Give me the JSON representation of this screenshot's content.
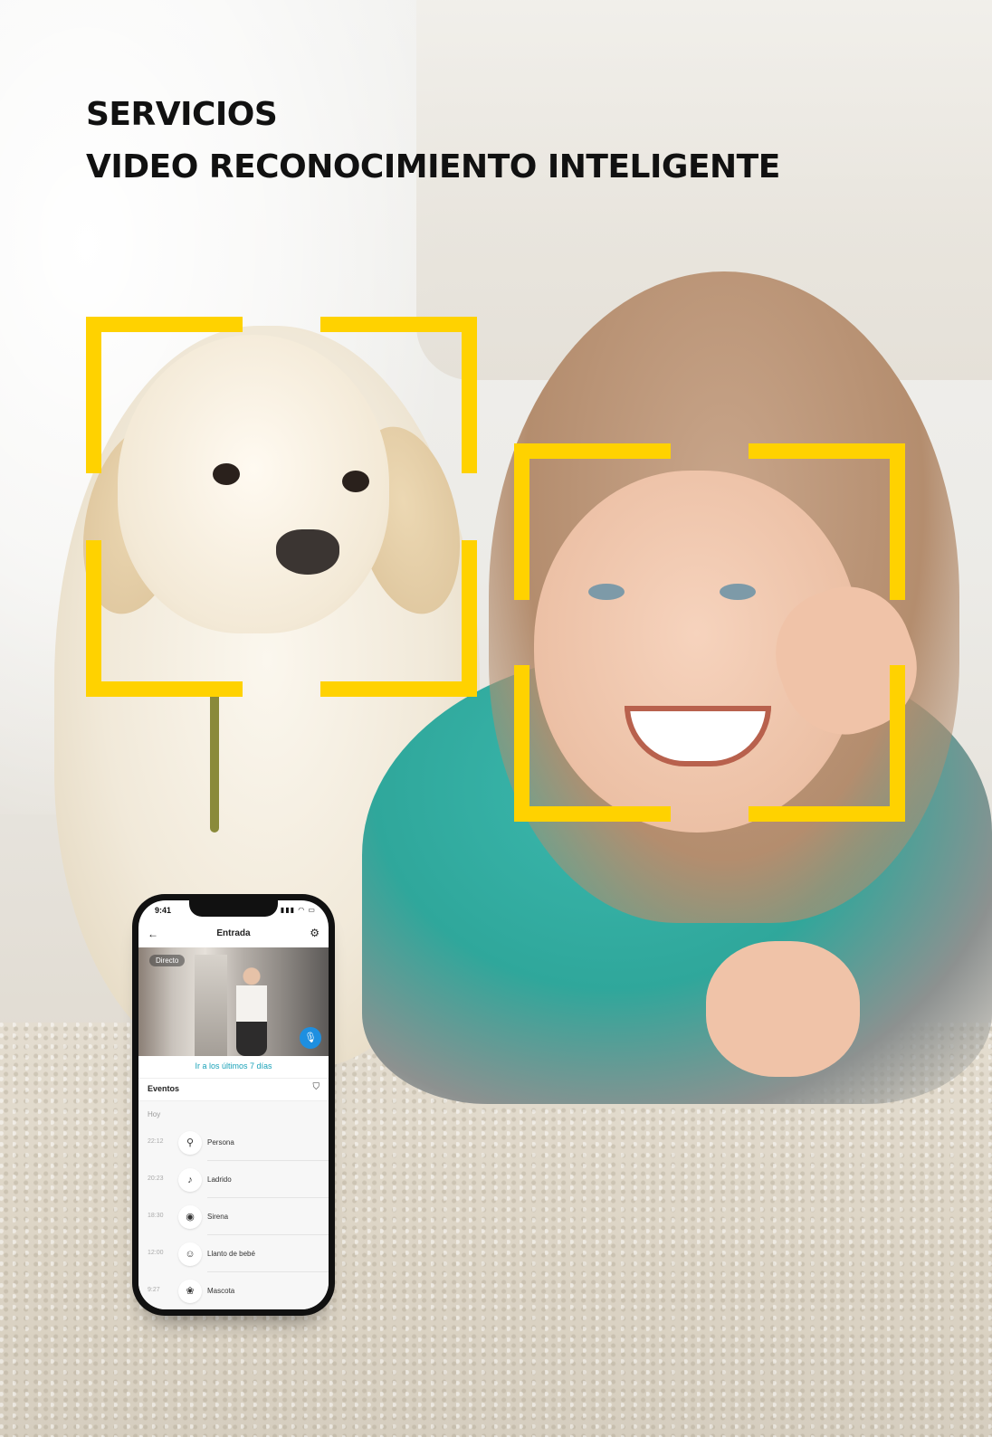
{
  "header": {
    "title_line1": "SERVICIOS",
    "title_line2": "VIDEO RECONOCIMIENTO INTELIGENTE"
  },
  "colors": {
    "accent": "#ffd200",
    "link": "#1aa2b8",
    "mic_button": "#1e8fe0"
  },
  "phone": {
    "status_time": "9:41",
    "status_icons": "signal-icon wifi-icon battery-icon",
    "nav": {
      "back_icon": "arrow-left-icon",
      "title": "Entrada",
      "settings_icon": "gear-icon"
    },
    "video": {
      "badge": "Directo",
      "mic_icon": "microphone-icon"
    },
    "link_text": "Ir a los últimos 7 días",
    "events": {
      "title": "Eventos",
      "filter_icon": "filter-icon",
      "day": "Hoy",
      "items": [
        {
          "time": "22:12",
          "label": "Persona",
          "icon": "person-icon"
        },
        {
          "time": "20:23",
          "label": "Ladrido",
          "icon": "bark-icon"
        },
        {
          "time": "18:30",
          "label": "Sirena",
          "icon": "siren-icon"
        },
        {
          "time": "12:00",
          "label": "Llanto de bebé",
          "icon": "baby-icon"
        },
        {
          "time": "9:27",
          "label": "Mascota",
          "icon": "paw-icon"
        }
      ]
    }
  }
}
